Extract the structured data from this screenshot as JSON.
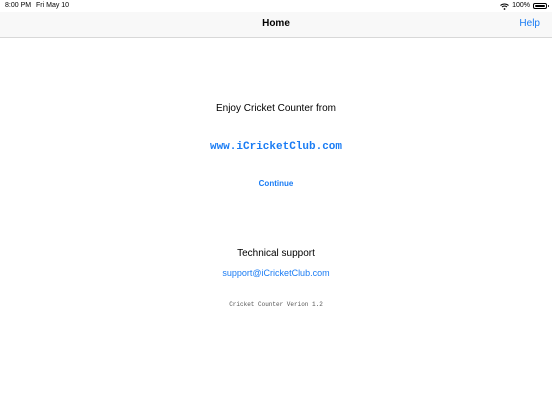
{
  "status_bar": {
    "time": "8:00 PM",
    "date": "Fri May 10",
    "battery": "100%"
  },
  "nav": {
    "title": "Home",
    "help_label": "Help"
  },
  "main": {
    "enjoy_text": "Enjoy Cricket Counter from",
    "website_link": "www.iCricketClub.com",
    "continue_label": "Continue",
    "tech_support_heading": "Technical support",
    "support_email": "support@iCricketClub.com",
    "version_text": "Cricket Counter Verion 1.2"
  },
  "colors": {
    "link": "#1a7cf4",
    "nav_background": "#f8f8f8"
  },
  "icons": {
    "wifi": "wifi-icon",
    "battery": "battery-icon"
  }
}
